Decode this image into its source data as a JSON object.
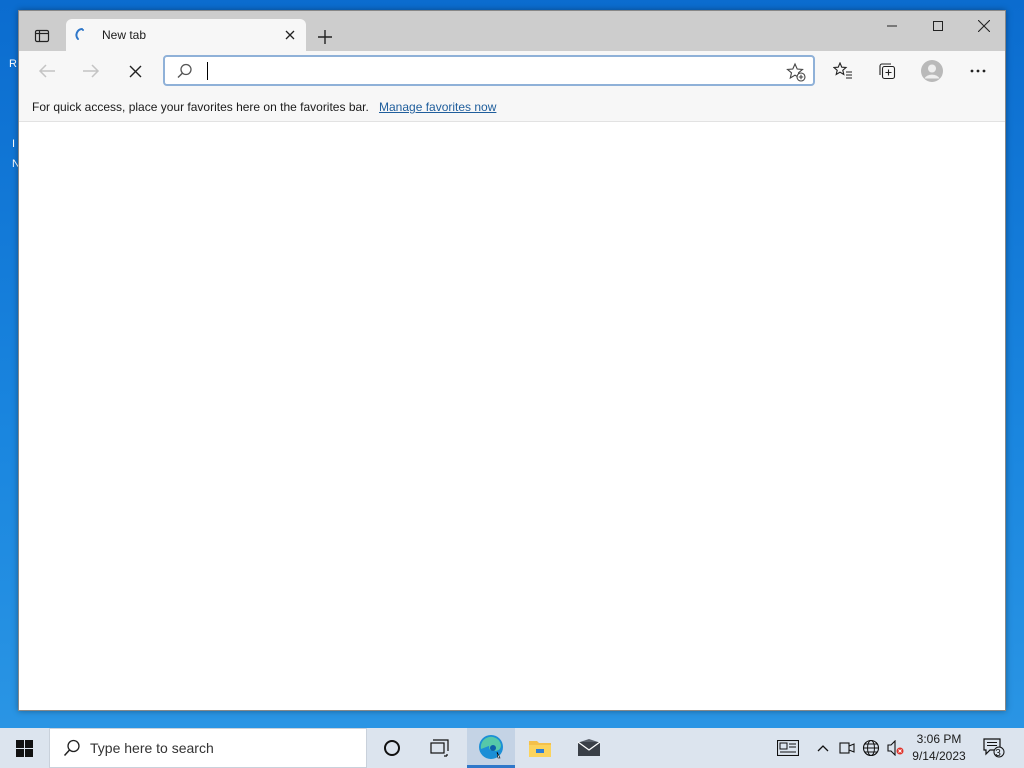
{
  "desktop": {
    "peek_letters": [
      "R",
      "I",
      "N"
    ]
  },
  "browser": {
    "tab": {
      "title": "New tab"
    },
    "address": {
      "value": "",
      "placeholder": ""
    },
    "favbar": {
      "message": "For quick access, place your favorites here on the favorites bar.",
      "link": "Manage favorites now"
    }
  },
  "taskbar": {
    "search_placeholder": "Type here to search",
    "clock": {
      "time": "3:06 PM",
      "date": "9/14/2023"
    },
    "notification_count": "3"
  },
  "colors": {
    "accent": "#2f77c9",
    "desktop_blue": "#1279d4",
    "link": "#1f5e9c"
  },
  "icons": {
    "tab_actions": "tab-actions-icon",
    "loading": "loading-spinner-icon",
    "close": "close-icon",
    "new_tab": "plus-icon",
    "minimize": "minimize-icon",
    "maximize": "maximize-icon",
    "back": "back-arrow-icon",
    "forward": "forward-arrow-icon",
    "stop": "stop-icon",
    "search": "search-icon",
    "add_favorite": "add-favorite-icon",
    "favorites": "favorites-icon",
    "collections": "collections-icon",
    "profile": "profile-icon",
    "more": "more-icon"
  }
}
